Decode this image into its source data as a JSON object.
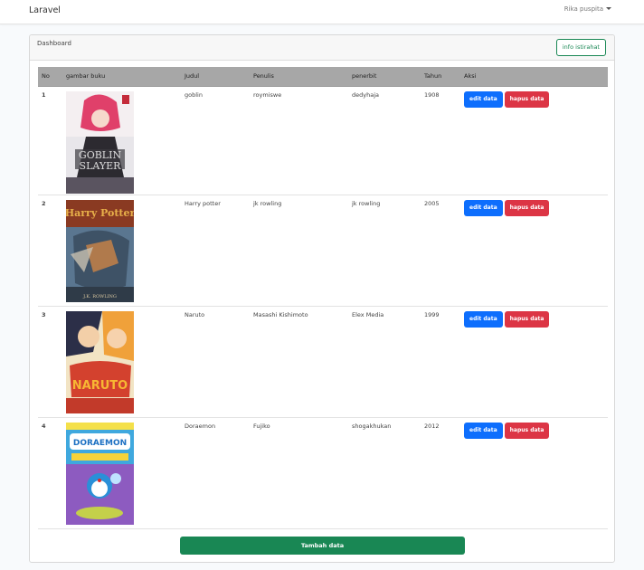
{
  "navbar": {
    "brand": "Laravel",
    "user_name": "Rika puspita"
  },
  "card": {
    "title": "Dashboard",
    "info_button": "info istirahat"
  },
  "table": {
    "headers": [
      "No",
      "gambar buku",
      "Judul",
      "Penulis",
      "penerbit",
      "Tahun",
      "Aksi"
    ],
    "rows": [
      {
        "no": "1",
        "judul": "goblin",
        "penulis": "roymiswe",
        "penerbit": "dedyhaja",
        "tahun": "1908",
        "cover_text": "GOBLIN SLAYER"
      },
      {
        "no": "2",
        "judul": "Harry potter",
        "penulis": "jk rowling",
        "penerbit": "jk rowling",
        "tahun": "2005",
        "cover_text": "Harry Potter"
      },
      {
        "no": "3",
        "judul": "Naruto",
        "penulis": "Masashi Kishimoto",
        "penerbit": "Elex Media",
        "tahun": "1999",
        "cover_text": "NARUTO"
      },
      {
        "no": "4",
        "judul": "Doraemon",
        "penulis": "Fujiko",
        "penerbit": "shogakhukan",
        "tahun": "2012",
        "cover_text": "DORAEMON"
      }
    ],
    "edit_label": "edit data",
    "delete_label": "hapus data"
  },
  "add_button": "Tambah data",
  "colors": {
    "primary": "#0d6efd",
    "danger": "#dc3545",
    "success": "#198754",
    "header_bg": "#a7a7a7"
  }
}
